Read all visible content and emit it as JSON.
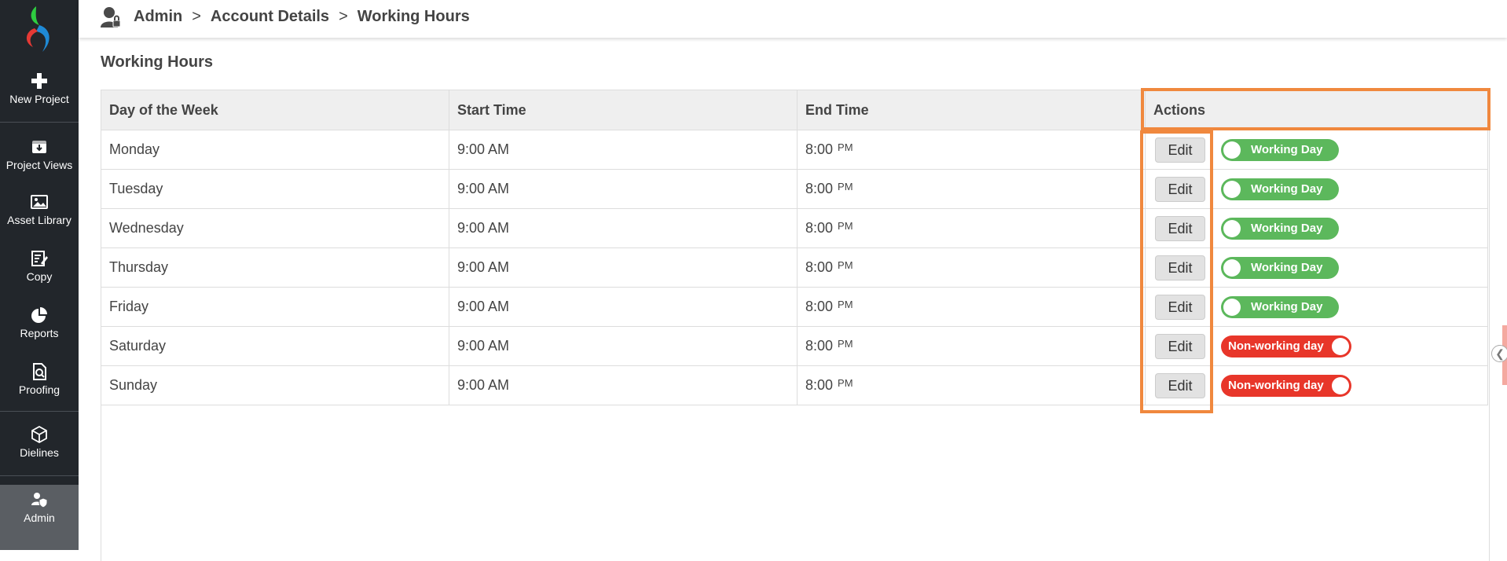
{
  "sidebar": {
    "items": [
      {
        "label": "New Project",
        "icon": "plus-icon"
      },
      {
        "label": "Project Views",
        "icon": "project-views-icon"
      },
      {
        "label": "Asset Library",
        "icon": "image-icon"
      },
      {
        "label": "Copy",
        "icon": "edit-document-icon"
      },
      {
        "label": "Reports",
        "icon": "pie-chart-icon"
      },
      {
        "label": "Proofing",
        "icon": "proofing-icon"
      },
      {
        "label": "Dielines",
        "icon": "box-icon"
      },
      {
        "label": "Admin",
        "icon": "admin-icon",
        "active": true
      }
    ]
  },
  "breadcrumb": {
    "items": [
      "Admin",
      "Account Details",
      "Working Hours"
    ],
    "separator": ">"
  },
  "page_title": "Working Hours",
  "table": {
    "headers": [
      "Day of the Week",
      "Start Time",
      "End Time",
      "Actions"
    ],
    "edit_label": "Edit",
    "rows": [
      {
        "day": "Monday",
        "start": "9:00 AM",
        "end_time": "8:00",
        "end_period": "PM",
        "status": "Working Day",
        "working": true
      },
      {
        "day": "Tuesday",
        "start": "9:00 AM",
        "end_time": "8:00",
        "end_period": "PM",
        "status": "Working Day",
        "working": true
      },
      {
        "day": "Wednesday",
        "start": "9:00 AM",
        "end_time": "8:00",
        "end_period": "PM",
        "status": "Working Day",
        "working": true
      },
      {
        "day": "Thursday",
        "start": "9:00 AM",
        "end_time": "8:00",
        "end_period": "PM",
        "status": "Working Day",
        "working": true
      },
      {
        "day": "Friday",
        "start": "9:00 AM",
        "end_time": "8:00",
        "end_period": "PM",
        "status": "Working Day",
        "working": true
      },
      {
        "day": "Saturday",
        "start": "9:00 AM",
        "end_time": "8:00",
        "end_period": "PM",
        "status": "Non-working day",
        "working": false
      },
      {
        "day": "Sunday",
        "start": "9:00 AM",
        "end_time": "8:00",
        "end_period": "PM",
        "status": "Non-working day",
        "working": false
      }
    ]
  },
  "colors": {
    "sidebar_bg": "#22262b",
    "working": "#5cb85c",
    "non_working": "#e8362a",
    "highlight": "#f0883e"
  }
}
